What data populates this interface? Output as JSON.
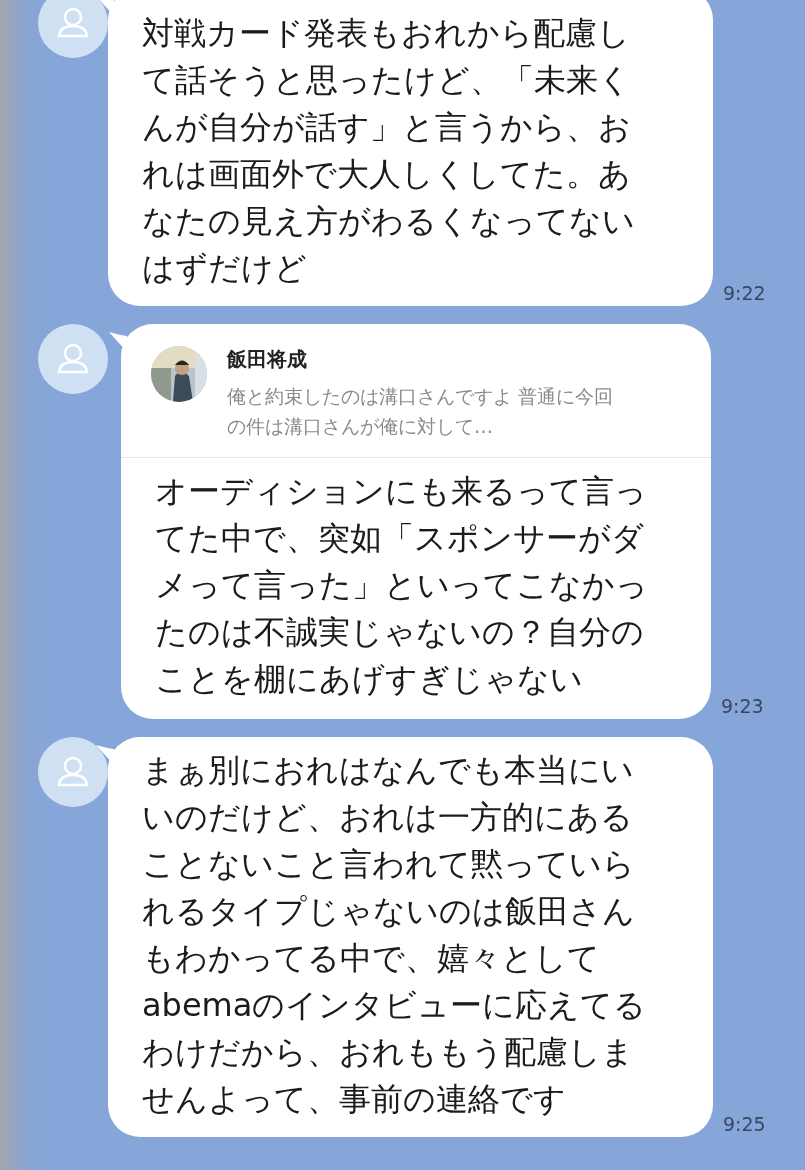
{
  "messages": [
    {
      "kind": "text",
      "text": "対戦カード発表もおれから配慮して話そうと思ったけど、「未来くんが自分が話す」と言うから、おれは画面外で大人しくしてた。あなたの見え方がわるくなってないはずだけど",
      "time": "9:22"
    },
    {
      "kind": "reply",
      "reply": {
        "kind": "picture",
        "name": "飯田将成",
        "text": "俺と約束したのは溝口さんですよ 普通に今回の件は溝口さんが俺に対して…"
      },
      "text": "オーディションにも来るって言ってた中で、突如「スポンサーがダメって言った」といってこなかったのは不誠実じゃないの？自分のことを棚にあげすぎじゃない",
      "time": "9:23"
    },
    {
      "kind": "text",
      "text": "まぁ別におれはなんでも本当にいいのだけど、おれは一方的にあることないこと言われて黙っていられるタイプじゃないのは飯田さんもわかってる中で、嬉々としてabemaのインタビューに応えてるわけだから、おれももう配慮しませんよって、事前の連絡です",
      "time": "9:25"
    }
  ]
}
